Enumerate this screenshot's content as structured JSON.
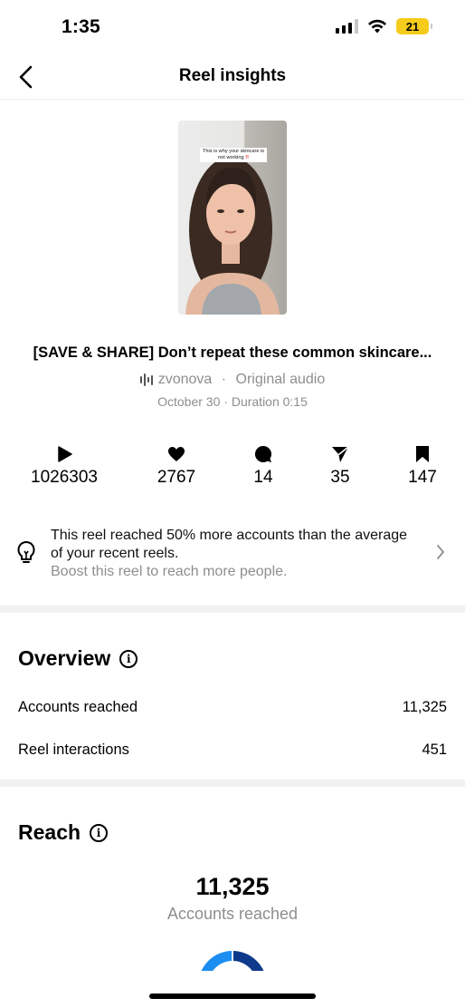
{
  "status": {
    "time": "1:35",
    "battery": "21"
  },
  "nav": {
    "title": "Reel insights"
  },
  "reel": {
    "thumbnail_caption_1": "This is why your skincare is",
    "thumbnail_caption_2": "not working",
    "thumbnail_caption_marks": "!!",
    "title": "[SAVE & SHARE] Don’t repeat these common skincare...",
    "audio_user": "zvonova",
    "audio_sep": " · ",
    "audio_label": "Original audio",
    "date": "October 30",
    "meta_sep": " · ",
    "duration": "Duration 0:15"
  },
  "stats": {
    "plays": "1026303",
    "likes": "2767",
    "comments": "14",
    "shares": "35",
    "saves": "147"
  },
  "insight": {
    "text": "This reel reached 50% more accounts than the average of your recent reels.",
    "sub": "Boost this reel to reach more people."
  },
  "overview": {
    "title": "Overview",
    "rows": [
      {
        "label": "Accounts reached",
        "value": "11,325"
      },
      {
        "label": "Reel interactions",
        "value": "451"
      }
    ]
  },
  "reach": {
    "title": "Reach",
    "value": "11,325",
    "label": "Accounts reached"
  },
  "colors": {
    "accent_blue": "#1c8ef0",
    "dark_blue": "#0f3a8c",
    "muted_text": "#8e8e8e",
    "battery_yellow": "#f5cc1b"
  }
}
